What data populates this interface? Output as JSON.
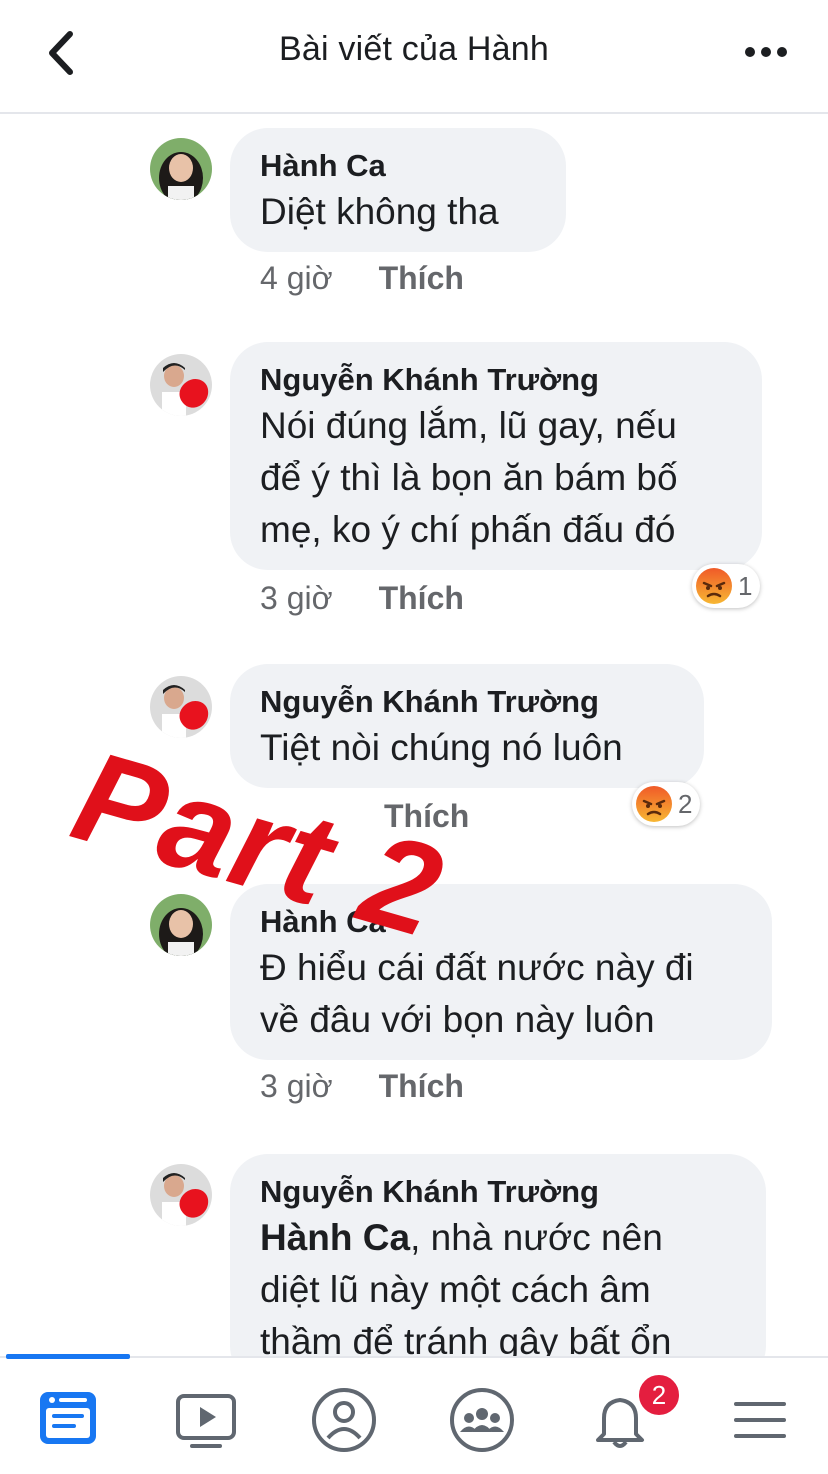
{
  "header": {
    "title": "Bài viết của Hành",
    "back_icon": "chevron-left-icon",
    "more_icon": "more-dots-icon"
  },
  "comments": [
    {
      "author": "Hành Ca",
      "text": "Diệt không tha",
      "time": "4 giờ",
      "like": "Thích"
    },
    {
      "author": "Nguyễn Khánh Trường",
      "lines": [
        "Nói đúng lắm, lũ gay, nếu",
        "để ý thì là bọn ăn bám bố",
        "mẹ, ko ý chí phấn đấu đó"
      ],
      "time": "3 giờ",
      "like": "Thích",
      "reaction": "angry",
      "reaction_count": "1"
    },
    {
      "author": "Nguyễn Khánh Trường",
      "text": "Tiệt nòi chúng nó luôn",
      "time": "",
      "like": "Thích",
      "reaction": "angry",
      "reaction_count": "2"
    },
    {
      "author": "Hành Ca",
      "lines": [
        "Đ hiểu cái đất nước này đi",
        "về đâu với bọn này luôn"
      ],
      "time": "3 giờ",
      "like": "Thích"
    },
    {
      "author": "Nguyễn Khánh Trường",
      "mention": "Hành Ca",
      "lines": [
        ", nhà nước nên",
        "diệt lũ này một cách âm",
        "thầm để tránh gây bất ổn"
      ]
    }
  ],
  "overlay": {
    "text": "Part 2",
    "color": "#e0101a"
  },
  "nav": {
    "items": [
      "feed-icon",
      "watch-icon",
      "profile-icon",
      "groups-icon",
      "notifications-icon",
      "menu-icon"
    ],
    "notification_count": "2",
    "accent": "#1877f2"
  }
}
